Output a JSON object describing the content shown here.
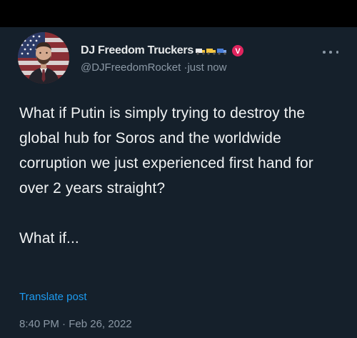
{
  "tweet": {
    "display_name": "DJ Freedom Truckers",
    "name_emoji_icons": [
      "truck-icon",
      "truck-icon",
      "truck-icon"
    ],
    "badge_letter": "V",
    "handle": "@DJFreedomRocket",
    "separator": "·",
    "relative_time": "just now",
    "body_line_1": "What if Putin is simply trying to destroy the global hub for Soros and the worldwide corruption we just experienced first hand for over 2 years straight?",
    "body_line_2": "What if...",
    "translate_label": "Translate post",
    "time": "8:40 PM",
    "date": "Feb 26, 2022"
  },
  "colors": {
    "background": "#15202b",
    "text": "#e7e9ea",
    "muted": "#8b98a5",
    "link": "#1d9bf0",
    "badge": "#e0245e"
  }
}
